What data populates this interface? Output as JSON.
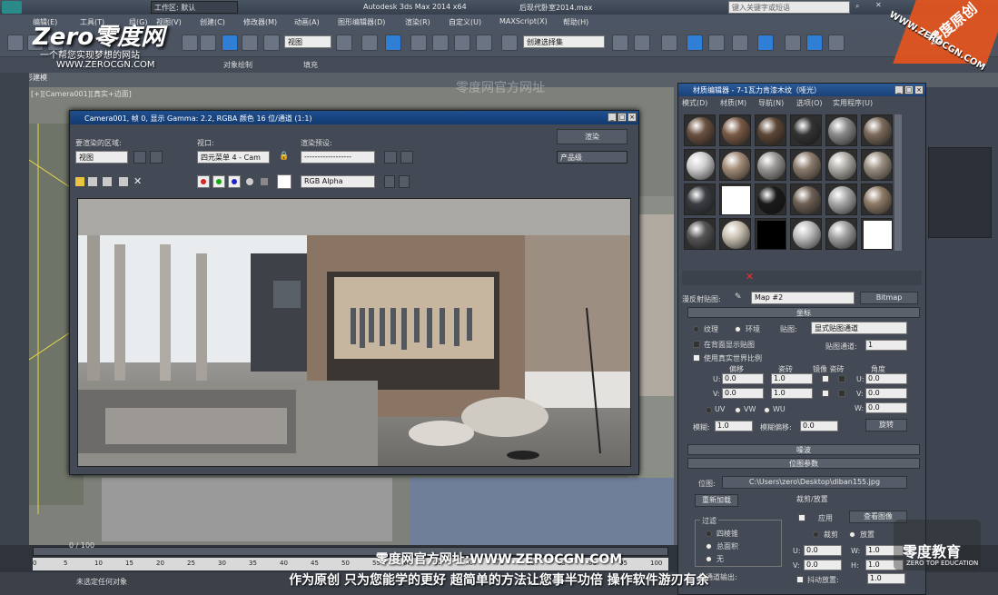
{
  "app": {
    "title": "Autodesk 3ds Max  2014 x64",
    "file": "后现代卧室2014.max",
    "workspace_label": "工作区: 默认",
    "search_placeholder": "键入关键字或短语"
  },
  "menu": [
    "编辑(E)",
    "工具(T)",
    "组(G)",
    "视图(V)",
    "创建(C)",
    "修改器(M)",
    "动画(A)",
    "图形编辑器(D)",
    "渲染(R)",
    "自定义(U)",
    "MAXScript(X)",
    "帮助(H)"
  ],
  "toolbar": {
    "view_combo": "视图",
    "selection_set": "创建选择集"
  },
  "ribbon": {
    "label1": "对象绘制",
    "label2": "填充",
    "poly_label": "多边形建模"
  },
  "viewport": {
    "label": "[+][Camera001][真实+边面]"
  },
  "render_window": {
    "title": "Camera001, 帧 0, 显示 Gamma: 2.2, RGBA 颜色 16 位/通道 (1:1)",
    "area_label": "要渲染的区域:",
    "area_value": "视图",
    "viewport_label": "视口:",
    "viewport_value": "四元菜单 4 - Cam",
    "preset_label": "渲染预设:",
    "preset_value": "------------------",
    "render_button": "渲染",
    "quality_value": "产品级",
    "channel_value": "RGB Alpha"
  },
  "material_editor": {
    "title": "材质编辑器 - 7-1瓦力肯漆木纹（哑光）",
    "menu": [
      "模式(D)",
      "材质(M)",
      "导航(N)",
      "选项(O)",
      "实用程序(U)"
    ],
    "map_label": "漫反射贴图:",
    "map_name": "Map #2",
    "map_type": "Bitmap",
    "rollout_coords": "坐标",
    "texture_radio": "纹理",
    "env_radio": "环境",
    "mapping_label": "贴图:",
    "mapping_value": "显式贴图通道",
    "show_back": "在背面显示贴图",
    "map_channel_label": "贴图通道:",
    "map_channel_value": "1",
    "real_world": "使用真实世界比例",
    "offset": "偏移",
    "tiling": "瓷砖",
    "mirror_tile": "镜像 瓷砖",
    "angle": "角度",
    "u_label": "U:",
    "v_label": "V:",
    "w_label": "W:",
    "u_offset": "0.0",
    "v_offset": "0.0",
    "u_tile": "1.0",
    "v_tile": "1.0",
    "u_angle": "0.0",
    "v_angle": "0.0",
    "w_angle": "0.0",
    "uv": "UV",
    "vw": "VW",
    "wu": "WU",
    "blur_label": "模糊:",
    "blur_value": "1.0",
    "blur_offset_label": "模糊偏移:",
    "blur_offset_value": "0.0",
    "rotate_button": "旋转",
    "rollout_noise": "噪波",
    "rollout_bitmap": "位图参数",
    "bitmap_label": "位图:",
    "bitmap_path": "C:\\Users\\zero\\Desktop\\diban155.jpg",
    "reload_button": "重新加载",
    "crop_label": "裁剪/放置",
    "apply_label": "应用",
    "view_image_button": "查看图像",
    "crop_radio": "裁剪",
    "place_radio": "放置",
    "filter_label": "过滤",
    "filter_pyramid": "四棱锥",
    "filter_sat": "总面积",
    "filter_none": "无",
    "crop_u": "0.0",
    "crop_w": "1.0",
    "crop_v": "0.0",
    "crop_h": "1.0",
    "jitter_label": "抖动放置:",
    "jitter_value": "1.0",
    "mono_label": "单通道输出:"
  },
  "timeline": {
    "frame": "0 / 100",
    "ticks": [
      "0",
      "5",
      "10",
      "15",
      "20",
      "25",
      "30",
      "35",
      "40",
      "45",
      "50",
      "55",
      "60",
      "65",
      "70",
      "75",
      "80",
      "85",
      "90",
      "95",
      "100"
    ]
  },
  "status": {
    "text": "未选定任何对象"
  },
  "watermark": {
    "logo": "Zero零度网",
    "slogan": "一个帮您实现梦想的网站",
    "url": "WWW.ZEROCGN.COM",
    "corner": "零度原创",
    "corner_url": "WWW.ZEROCGN.COM",
    "center": "零度网官方网址",
    "edu": "零度教育",
    "edu_en": "ZERO TOP EDUCATION"
  },
  "subtitle": {
    "line1": "零度网官方网址:WWW.ZEROCGN.COM",
    "line2": "作为原创 只为您能学的更好 超简单的方法让您事半功倍 操作软件游刃有余"
  }
}
